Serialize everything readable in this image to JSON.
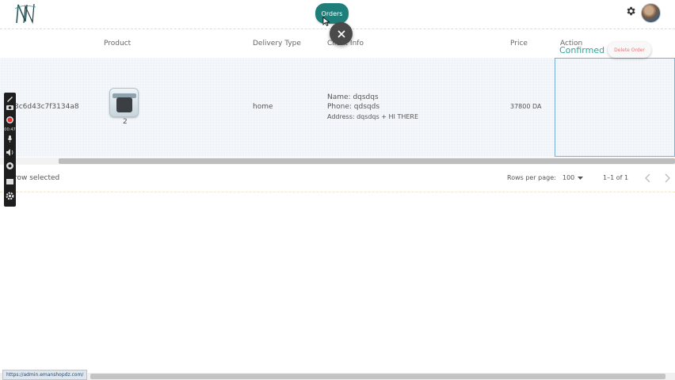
{
  "header": {
    "logo_text": "N",
    "active_tab": "Orders"
  },
  "table": {
    "columns": [
      "Product",
      "Delivery Type",
      "Client Info",
      "Price",
      "Action"
    ],
    "row": {
      "order_id": "3c6d43c7f3134a8",
      "product_quantity": "2",
      "delivery_type": "home",
      "client_name": "Name: dqsdqs",
      "client_phone": "Phone: qdsqds",
      "client_address": "Address: dqsdqs + HI THERE",
      "price": "37800 DA",
      "status": "Confirmed",
      "delete_label": "Delete Order"
    }
  },
  "footer": {
    "selected_text": "row selected",
    "rows_per_page_label": "Rows per page:",
    "rows_per_page_value": "100",
    "pagination_text": "1–1 of 1"
  },
  "recorder": {
    "time": "00:47"
  },
  "statusbar": {
    "url": "https://admin.emanshopdz.com/"
  },
  "colors": {
    "accent": "#1e7f7a",
    "confirmed": "#2aa69a",
    "delete": "#e07a7a",
    "selected_row": "#e9eff6"
  }
}
